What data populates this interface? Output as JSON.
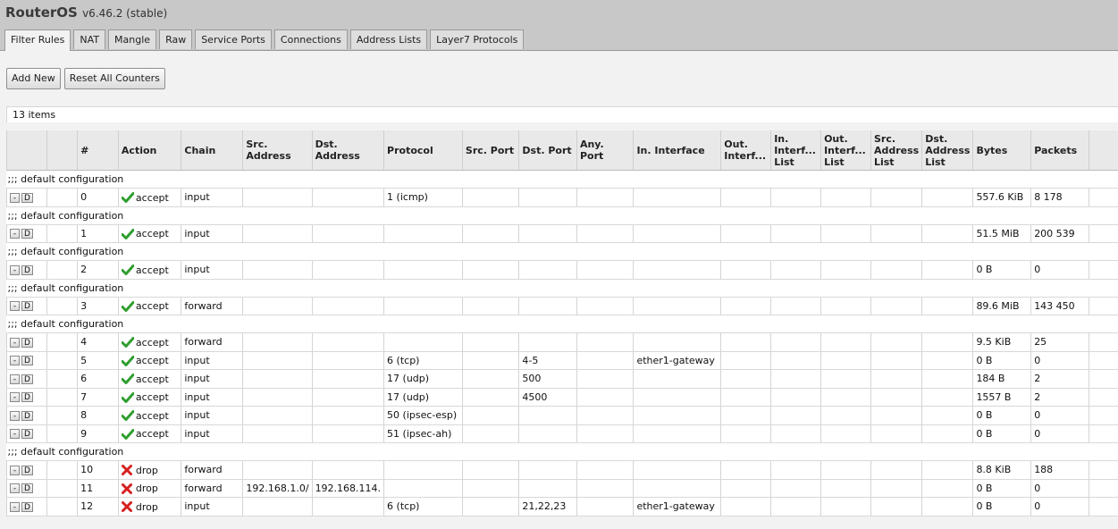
{
  "app": {
    "name": "RouterOS",
    "version": "v6.46.2 (stable)"
  },
  "tabs": [
    "Filter Rules",
    "NAT",
    "Mangle",
    "Raw",
    "Service Ports",
    "Connections",
    "Address Lists",
    "Layer7 Protocols"
  ],
  "toolbar": {
    "add_new": "Add New",
    "reset_counters": "Reset All Counters"
  },
  "item_count": "13 items",
  "columns": [
    "#",
    "Action",
    "Chain",
    "Src. Address",
    "Dst. Address",
    "Protocol",
    "Src. Port",
    "Dst. Port",
    "Any. Port",
    "In. Interface",
    "Out. Interf...",
    "In. Interf... List",
    "Out. Interf... List",
    "Src. Address List",
    "Dst. Address List",
    "Bytes",
    "Packets"
  ],
  "row_buttons": {
    "remove": "-",
    "disable": "D"
  },
  "rows": [
    {
      "comment": ";;; default configuration"
    },
    {
      "num": "0",
      "action": "accept",
      "action_icon": "check-icon",
      "chain": "input",
      "src_address": "",
      "dst_address": "",
      "protocol": "1 (icmp)",
      "src_port": "",
      "dst_port": "",
      "in_interface": "",
      "bytes": "557.6 KiB",
      "packets": "8 178"
    },
    {
      "comment": ";;; default configuration"
    },
    {
      "num": "1",
      "action": "accept",
      "action_icon": "check-icon",
      "chain": "input",
      "src_address": "",
      "dst_address": "",
      "protocol": "",
      "src_port": "",
      "dst_port": "",
      "in_interface": "",
      "bytes": "51.5 MiB",
      "packets": "200 539"
    },
    {
      "comment": ";;; default configuration"
    },
    {
      "num": "2",
      "action": "accept",
      "action_icon": "check-icon",
      "chain": "input",
      "src_address": "",
      "dst_address": "",
      "protocol": "",
      "src_port": "",
      "dst_port": "",
      "in_interface": "",
      "bytes": "0 B",
      "packets": "0"
    },
    {
      "comment": ";;; default configuration"
    },
    {
      "num": "3",
      "action": "accept",
      "action_icon": "check-icon",
      "chain": "forward",
      "src_address": "",
      "dst_address": "",
      "protocol": "",
      "src_port": "",
      "dst_port": "",
      "in_interface": "",
      "bytes": "89.6 MiB",
      "packets": "143 450"
    },
    {
      "comment": ";;; default configuration"
    },
    {
      "num": "4",
      "action": "accept",
      "action_icon": "check-icon",
      "chain": "forward",
      "src_address": "",
      "dst_address": "",
      "protocol": "",
      "src_port": "",
      "dst_port": "",
      "in_interface": "",
      "bytes": "9.5 KiB",
      "packets": "25"
    },
    {
      "num": "5",
      "action": "accept",
      "action_icon": "check-icon",
      "chain": "input",
      "src_address": "",
      "dst_address": "",
      "protocol": "6 (tcp)",
      "src_port": "",
      "dst_port": "4-5",
      "in_interface": "ether1-gateway",
      "bytes": "0 B",
      "packets": "0"
    },
    {
      "num": "6",
      "action": "accept",
      "action_icon": "check-icon",
      "chain": "input",
      "src_address": "",
      "dst_address": "",
      "protocol": "17 (udp)",
      "src_port": "",
      "dst_port": "500",
      "in_interface": "",
      "bytes": "184 B",
      "packets": "2"
    },
    {
      "num": "7",
      "action": "accept",
      "action_icon": "check-icon",
      "chain": "input",
      "src_address": "",
      "dst_address": "",
      "protocol": "17 (udp)",
      "src_port": "",
      "dst_port": "4500",
      "in_interface": "",
      "bytes": "1557 B",
      "packets": "2"
    },
    {
      "num": "8",
      "action": "accept",
      "action_icon": "check-icon",
      "chain": "input",
      "src_address": "",
      "dst_address": "",
      "protocol": "50 (ipsec-esp)",
      "src_port": "",
      "dst_port": "",
      "in_interface": "",
      "bytes": "0 B",
      "packets": "0"
    },
    {
      "num": "9",
      "action": "accept",
      "action_icon": "check-icon",
      "chain": "input",
      "src_address": "",
      "dst_address": "",
      "protocol": "51 (ipsec-ah)",
      "src_port": "",
      "dst_port": "",
      "in_interface": "",
      "bytes": "0 B",
      "packets": "0"
    },
    {
      "comment": ";;; default configuration"
    },
    {
      "num": "10",
      "action": "drop",
      "action_icon": "cross-icon",
      "chain": "forward",
      "src_address": "",
      "dst_address": "",
      "protocol": "",
      "src_port": "",
      "dst_port": "",
      "in_interface": "",
      "bytes": "8.8 KiB",
      "packets": "188"
    },
    {
      "num": "11",
      "action": "drop",
      "action_icon": "cross-icon",
      "chain": "forward",
      "src_address": "192.168.1.0/",
      "dst_address": "192.168.114.",
      "protocol": "",
      "src_port": "",
      "dst_port": "",
      "in_interface": "",
      "bytes": "0 B",
      "packets": "0"
    },
    {
      "num": "12",
      "action": "drop",
      "action_icon": "cross-icon",
      "chain": "input",
      "src_address": "",
      "dst_address": "",
      "protocol": "6 (tcp)",
      "src_port": "",
      "dst_port": "21,22,23",
      "in_interface": "ether1-gateway",
      "bytes": "0 B",
      "packets": "0"
    }
  ],
  "colors": {
    "accept": "#2e9e2e",
    "drop": "#d62020",
    "topbar": "#c8c8c8"
  }
}
